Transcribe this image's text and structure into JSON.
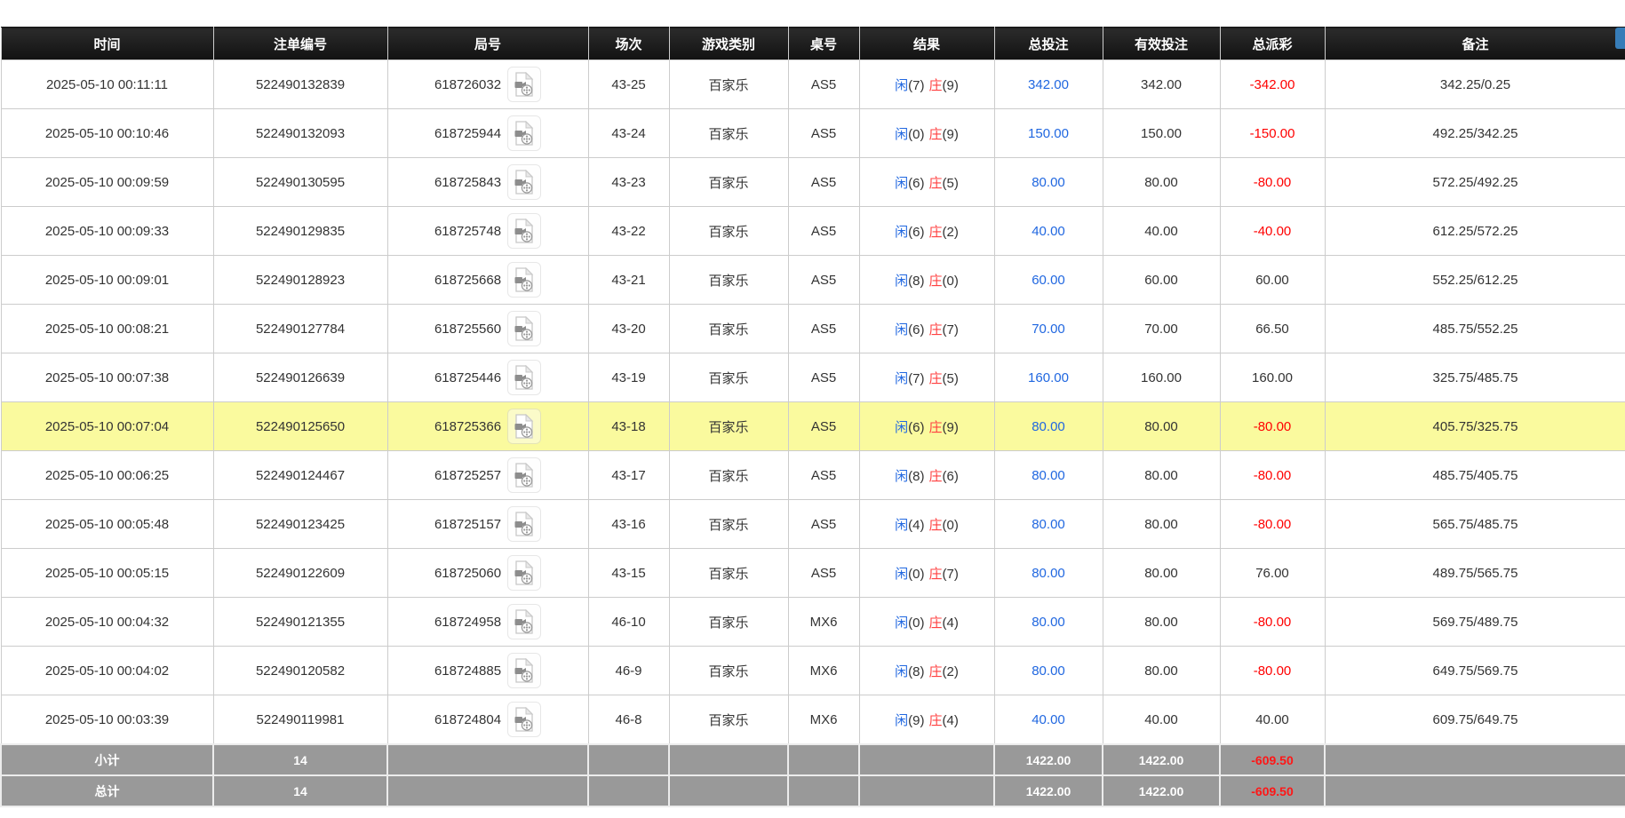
{
  "colors": {
    "header_bg": "#1b1b1b",
    "accent_blue": "#2067e0",
    "banker_red": "#ff4040",
    "negative_red": "#ff0000",
    "highlight_yellow": "#fafa9e",
    "summary_bg": "#999999",
    "top_button_blue": "#377db8"
  },
  "table": {
    "columns": [
      {
        "key": "time",
        "label": "时间"
      },
      {
        "key": "bet-id",
        "label": "注单编号"
      },
      {
        "key": "round",
        "label": "局号"
      },
      {
        "key": "session",
        "label": "场次"
      },
      {
        "key": "game-type",
        "label": "游戏类别"
      },
      {
        "key": "table-no",
        "label": "桌号"
      },
      {
        "key": "result",
        "label": "结果"
      },
      {
        "key": "total-bet",
        "label": "总投注"
      },
      {
        "key": "valid-bet",
        "label": "有效投注"
      },
      {
        "key": "total-payout",
        "label": "总派彩"
      },
      {
        "key": "remark",
        "label": "备注"
      }
    ],
    "rows": [
      {
        "time": "2025-05-10 00:11:11",
        "bet_id": "522490132839",
        "round": "618726032",
        "session": "43-25",
        "game_type": "百家乐",
        "table_no": "AS5",
        "player_label": "闲",
        "player_num": "(7)",
        "banker_label": "庄",
        "banker_num": "(9)",
        "total_bet": "342.00",
        "valid_bet": "342.00",
        "total_payout": "-342.00",
        "remark": "342.25/0.25",
        "highlighted": false
      },
      {
        "time": "2025-05-10 00:10:46",
        "bet_id": "522490132093",
        "round": "618725944",
        "session": "43-24",
        "game_type": "百家乐",
        "table_no": "AS5",
        "player_label": "闲",
        "player_num": "(0)",
        "banker_label": "庄",
        "banker_num": "(9)",
        "total_bet": "150.00",
        "valid_bet": "150.00",
        "total_payout": "-150.00",
        "remark": "492.25/342.25",
        "highlighted": false
      },
      {
        "time": "2025-05-10 00:09:59",
        "bet_id": "522490130595",
        "round": "618725843",
        "session": "43-23",
        "game_type": "百家乐",
        "table_no": "AS5",
        "player_label": "闲",
        "player_num": "(6)",
        "banker_label": "庄",
        "banker_num": "(5)",
        "total_bet": "80.00",
        "valid_bet": "80.00",
        "total_payout": "-80.00",
        "remark": "572.25/492.25",
        "highlighted": false
      },
      {
        "time": "2025-05-10 00:09:33",
        "bet_id": "522490129835",
        "round": "618725748",
        "session": "43-22",
        "game_type": "百家乐",
        "table_no": "AS5",
        "player_label": "闲",
        "player_num": "(6)",
        "banker_label": "庄",
        "banker_num": "(2)",
        "total_bet": "40.00",
        "valid_bet": "40.00",
        "total_payout": "-40.00",
        "remark": "612.25/572.25",
        "highlighted": false
      },
      {
        "time": "2025-05-10 00:09:01",
        "bet_id": "522490128923",
        "round": "618725668",
        "session": "43-21",
        "game_type": "百家乐",
        "table_no": "AS5",
        "player_label": "闲",
        "player_num": "(8)",
        "banker_label": "庄",
        "banker_num": "(0)",
        "total_bet": "60.00",
        "valid_bet": "60.00",
        "total_payout": "60.00",
        "remark": "552.25/612.25",
        "highlighted": false
      },
      {
        "time": "2025-05-10 00:08:21",
        "bet_id": "522490127784",
        "round": "618725560",
        "session": "43-20",
        "game_type": "百家乐",
        "table_no": "AS5",
        "player_label": "闲",
        "player_num": "(6)",
        "banker_label": "庄",
        "banker_num": "(7)",
        "total_bet": "70.00",
        "valid_bet": "70.00",
        "total_payout": "66.50",
        "remark": "485.75/552.25",
        "highlighted": false
      },
      {
        "time": "2025-05-10 00:07:38",
        "bet_id": "522490126639",
        "round": "618725446",
        "session": "43-19",
        "game_type": "百家乐",
        "table_no": "AS5",
        "player_label": "闲",
        "player_num": "(7)",
        "banker_label": "庄",
        "banker_num": "(5)",
        "total_bet": "160.00",
        "valid_bet": "160.00",
        "total_payout": "160.00",
        "remark": "325.75/485.75",
        "highlighted": false
      },
      {
        "time": "2025-05-10 00:07:04",
        "bet_id": "522490125650",
        "round": "618725366",
        "session": "43-18",
        "game_type": "百家乐",
        "table_no": "AS5",
        "player_label": "闲",
        "player_num": "(6)",
        "banker_label": "庄",
        "banker_num": "(9)",
        "total_bet": "80.00",
        "valid_bet": "80.00",
        "total_payout": "-80.00",
        "remark": "405.75/325.75",
        "highlighted": true
      },
      {
        "time": "2025-05-10 00:06:25",
        "bet_id": "522490124467",
        "round": "618725257",
        "session": "43-17",
        "game_type": "百家乐",
        "table_no": "AS5",
        "player_label": "闲",
        "player_num": "(8)",
        "banker_label": "庄",
        "banker_num": "(6)",
        "total_bet": "80.00",
        "valid_bet": "80.00",
        "total_payout": "-80.00",
        "remark": "485.75/405.75",
        "highlighted": false
      },
      {
        "time": "2025-05-10 00:05:48",
        "bet_id": "522490123425",
        "round": "618725157",
        "session": "43-16",
        "game_type": "百家乐",
        "table_no": "AS5",
        "player_label": "闲",
        "player_num": "(4)",
        "banker_label": "庄",
        "banker_num": "(0)",
        "total_bet": "80.00",
        "valid_bet": "80.00",
        "total_payout": "-80.00",
        "remark": "565.75/485.75",
        "highlighted": false
      },
      {
        "time": "2025-05-10 00:05:15",
        "bet_id": "522490122609",
        "round": "618725060",
        "session": "43-15",
        "game_type": "百家乐",
        "table_no": "AS5",
        "player_label": "闲",
        "player_num": "(0)",
        "banker_label": "庄",
        "banker_num": "(7)",
        "total_bet": "80.00",
        "valid_bet": "80.00",
        "total_payout": "76.00",
        "remark": "489.75/565.75",
        "highlighted": false
      },
      {
        "time": "2025-05-10 00:04:32",
        "bet_id": "522490121355",
        "round": "618724958",
        "session": "46-10",
        "game_type": "百家乐",
        "table_no": "MX6",
        "player_label": "闲",
        "player_num": "(0)",
        "banker_label": "庄",
        "banker_num": "(4)",
        "total_bet": "80.00",
        "valid_bet": "80.00",
        "total_payout": "-80.00",
        "remark": "569.75/489.75",
        "highlighted": false
      },
      {
        "time": "2025-05-10 00:04:02",
        "bet_id": "522490120582",
        "round": "618724885",
        "session": "46-9",
        "game_type": "百家乐",
        "table_no": "MX6",
        "player_label": "闲",
        "player_num": "(8)",
        "banker_label": "庄",
        "banker_num": "(2)",
        "total_bet": "80.00",
        "valid_bet": "80.00",
        "total_payout": "-80.00",
        "remark": "649.75/569.75",
        "highlighted": false
      },
      {
        "time": "2025-05-10 00:03:39",
        "bet_id": "522490119981",
        "round": "618724804",
        "session": "46-8",
        "game_type": "百家乐",
        "table_no": "MX6",
        "player_label": "闲",
        "player_num": "(9)",
        "banker_label": "庄",
        "banker_num": "(4)",
        "total_bet": "40.00",
        "valid_bet": "40.00",
        "total_payout": "40.00",
        "remark": "609.75/649.75",
        "highlighted": false
      }
    ],
    "summary_rows": [
      {
        "label": "小计",
        "count": "14",
        "total_bet": "1422.00",
        "valid_bet": "1422.00",
        "total_payout": "-609.50"
      },
      {
        "label": "总计",
        "count": "14",
        "total_bet": "1422.00",
        "valid_bet": "1422.00",
        "total_payout": "-609.50"
      }
    ]
  }
}
